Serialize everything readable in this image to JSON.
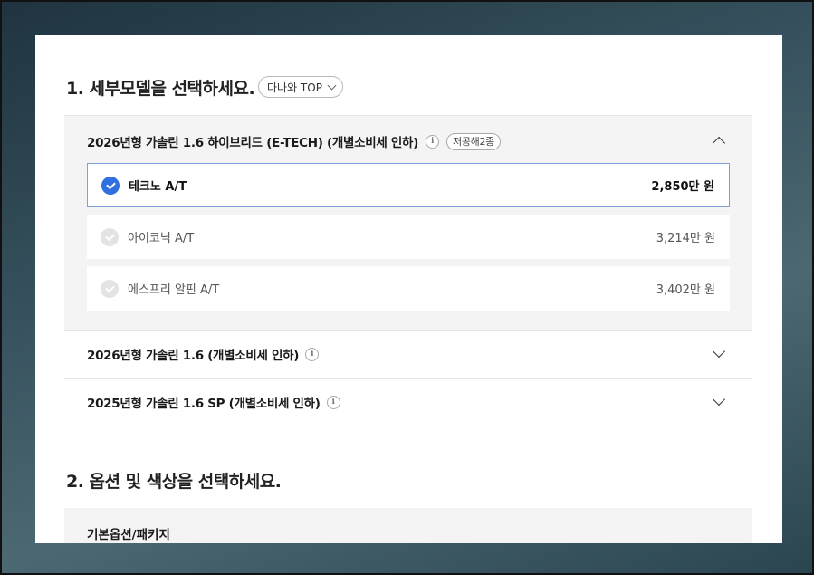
{
  "section1": {
    "title": "1. 세부모델을 선택하세요.",
    "pill_label": "다나와 TOP"
  },
  "trims": [
    {
      "title": "2026년형 가솔린 1.6 하이브리드 (E-TECH) (개별소비세 인하)",
      "tag": "저공해2종",
      "expanded": true,
      "options": [
        {
          "name": "테크노 A/T",
          "price": "2,850만 원",
          "selected": true
        },
        {
          "name": "아이코닉 A/T",
          "price": "3,214만 원",
          "selected": false
        },
        {
          "name": "에스프리 알핀 A/T",
          "price": "3,402만 원",
          "selected": false
        }
      ]
    },
    {
      "title": "2026년형 가솔린 1.6 (개별소비세 인하)",
      "expanded": false
    },
    {
      "title": "2025년형 가솔린 1.6 SP (개별소비세 인하)",
      "expanded": false
    }
  ],
  "section2": {
    "title": "2. 옵션 및 색상을 선택하세요.",
    "package_label": "기본옵션/패키지"
  },
  "colors": {
    "accent": "#2f6fe0",
    "selected_border": "#7f9fd8"
  }
}
